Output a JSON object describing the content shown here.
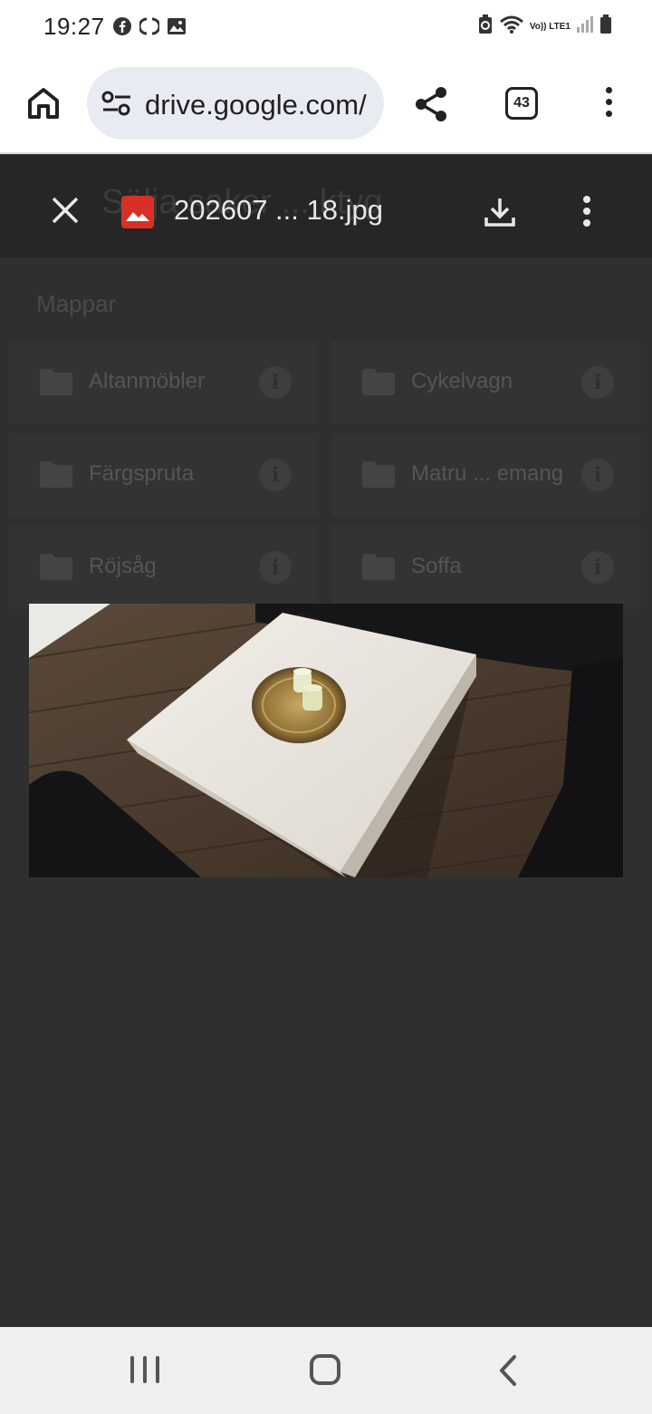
{
  "status_bar": {
    "time": "19:27",
    "notification_icons": [
      "facebook-icon",
      "sync-icon",
      "image-icon"
    ],
    "network_label": "Vo)) LTE1",
    "system_icons": [
      "battery-saver-icon",
      "wifi-icon",
      "signal-icon",
      "battery-icon"
    ]
  },
  "browser": {
    "url": "drive.google.com/",
    "tab_count": "43"
  },
  "drive": {
    "title": "Sälja saker ... ktyg",
    "section_label": "Mappar",
    "folders": [
      {
        "name": "Altanmöbler"
      },
      {
        "name": "Cykelvagn"
      },
      {
        "name": "Färgspruta"
      },
      {
        "name": "Matru ... emang"
      },
      {
        "name": "Röjsåg"
      },
      {
        "name": "Soffa"
      }
    ],
    "info_glyph": "i"
  },
  "viewer": {
    "file_name": "202607 ... 18.jpg",
    "file_icon": "image-file-icon",
    "colors": {
      "file_icon": "#d93025"
    }
  }
}
